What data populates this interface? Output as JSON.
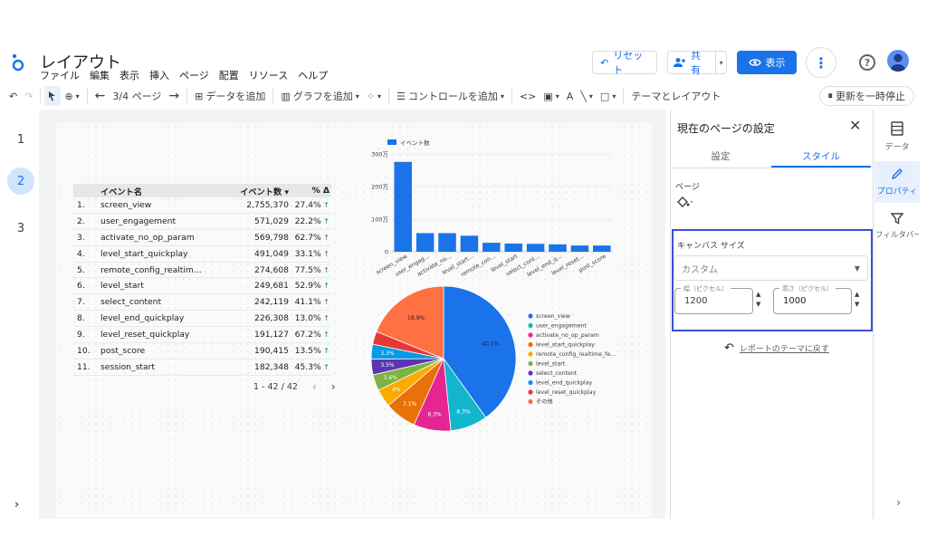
{
  "app": {
    "title": "レイアウト"
  },
  "menu": [
    "ファイル",
    "編集",
    "表示",
    "挿入",
    "ページ",
    "配置",
    "リソース",
    "ヘルプ"
  ],
  "header": {
    "reset": "リセット",
    "share": "共有",
    "view": "表示"
  },
  "toolbar": {
    "page_indicator": "3/4 ページ",
    "add_data": "データを追加",
    "add_chart": "グラフを追加",
    "add_control": "コントロールを追加",
    "theme_layout": "テーマとレイアウト",
    "pause_update": "更新を一時停止"
  },
  "pages": [
    "1",
    "2",
    "3"
  ],
  "table": {
    "headers": {
      "name": "イベント名",
      "count": "イベント数 ▾",
      "pct": "% Δ"
    },
    "rows": [
      {
        "idx": "1.",
        "name": "screen_view",
        "count": "2,755,370",
        "pct": "27.4%"
      },
      {
        "idx": "2.",
        "name": "user_engagement",
        "count": "571,029",
        "pct": "22.2%"
      },
      {
        "idx": "3.",
        "name": "activate_no_op_param",
        "count": "569,798",
        "pct": "62.7%"
      },
      {
        "idx": "4.",
        "name": "level_start_quickplay",
        "count": "491,049",
        "pct": "33.1%"
      },
      {
        "idx": "5.",
        "name": "remote_config_realtim...",
        "count": "274,608",
        "pct": "77.5%"
      },
      {
        "idx": "6.",
        "name": "level_start",
        "count": "249,681",
        "pct": "52.9%"
      },
      {
        "idx": "7.",
        "name": "select_content",
        "count": "242,119",
        "pct": "41.1%"
      },
      {
        "idx": "8.",
        "name": "level_end_quickplay",
        "count": "226,308",
        "pct": "13.0%"
      },
      {
        "idx": "9.",
        "name": "level_reset_quickplay",
        "count": "191,127",
        "pct": "67.2%"
      },
      {
        "idx": "10.",
        "name": "post_score",
        "count": "190,415",
        "pct": "13.5%"
      },
      {
        "idx": "11.",
        "name": "session_start",
        "count": "182,348",
        "pct": "45.3%"
      }
    ],
    "pager": "1 - 42 / 42"
  },
  "chart_data": [
    {
      "type": "bar",
      "legend": "イベント数",
      "legend_position": "top",
      "color": "#1a73e8",
      "y_ticks": [
        "0",
        "100万",
        "200万",
        "300万"
      ],
      "ylim": [
        0,
        3000000
      ],
      "categories": [
        "screen_view",
        "user_engag...",
        "activate_no...",
        "level_start...",
        "remote_con...",
        "level_start",
        "select_cont...",
        "level_end_q...",
        "level_reset...",
        "post_score"
      ],
      "values": [
        2755370,
        571029,
        569798,
        491049,
        274608,
        249681,
        242119,
        226308,
        191127,
        190415
      ]
    },
    {
      "type": "pie",
      "legend_position": "right",
      "slices": [
        {
          "label": "screen_view",
          "value": 40.1,
          "text": "40.1%",
          "color": "#1a73e8"
        },
        {
          "label": "user_engagement",
          "value": 8.3,
          "text": "8.3%",
          "color": "#12b5cb"
        },
        {
          "label": "activate_no_op_param",
          "value": 8.3,
          "text": "8.3%",
          "color": "#e52592"
        },
        {
          "label": "level_start_quickplay",
          "value": 7.1,
          "text": "7.1%",
          "color": "#e8710a"
        },
        {
          "label": "remote_config_realtime_fe...",
          "value": 4.0,
          "text": "4%",
          "color": "#f9ab00"
        },
        {
          "label": "level_start",
          "value": 3.6,
          "text": "3.6%",
          "color": "#7cb342"
        },
        {
          "label": "select_content",
          "value": 3.5,
          "text": "3.5%",
          "color": "#5e35b1"
        },
        {
          "label": "level_end_quickplay",
          "value": 3.3,
          "text": "3.3%",
          "color": "#039be5"
        },
        {
          "label": "level_reset_quickplay",
          "value": 2.9,
          "text": "",
          "color": "#e53935"
        },
        {
          "label": "その他",
          "value": 18.9,
          "text": "18.9%",
          "color": "#ff7043"
        }
      ]
    }
  ],
  "panel": {
    "title": "現在のページの設定",
    "tabs": [
      "設定",
      "スタイル"
    ],
    "page_label": "ページ",
    "canvas_size_label": "キャンバス サイズ",
    "canvas_size_value": "カスタム",
    "width_label": "幅（ピクセル）",
    "width_value": "1200",
    "height_label": "高さ（ピクセル）",
    "height_value": "1000",
    "revert": "レポートのテーマに戻す"
  },
  "rail": {
    "data": "データ",
    "properties": "プロパティ",
    "filter": "フィルタバー"
  }
}
